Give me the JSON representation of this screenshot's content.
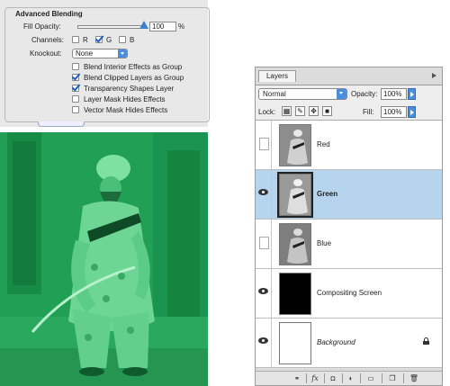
{
  "advanced_blending": {
    "title": "Advanced Blending",
    "fill_opacity_label": "Fill Opacity:",
    "fill_opacity_value": "100",
    "fill_opacity_unit": "%",
    "fill_opacity_level": 1.0,
    "channels_label": "Channels:",
    "channels": [
      {
        "label": "R",
        "checked": false
      },
      {
        "label": "G",
        "checked": true
      },
      {
        "label": "B",
        "checked": false
      }
    ],
    "knockout_label": "Knockout:",
    "knockout_value": "None",
    "options": [
      {
        "label": "Blend Interior Effects as Group",
        "checked": false
      },
      {
        "label": "Blend Clipped Layers as Group",
        "checked": true
      },
      {
        "label": "Transparency Shapes Layer",
        "checked": true
      },
      {
        "label": "Layer Mask Hides Effects",
        "checked": false
      },
      {
        "label": "Vector Mask Hides Effects",
        "checked": false
      }
    ]
  },
  "photo": {
    "tint_color": "#1e9a52"
  },
  "layers_panel": {
    "tab_label": "Layers",
    "blend_mode": "Normal",
    "opacity_label": "Opacity:",
    "opacity_value": "100%",
    "lock_label": "Lock:",
    "fill_label": "Fill:",
    "fill_value": "100%",
    "lock_icons": [
      "lock-transparent-icon",
      "lock-image-icon",
      "lock-position-icon",
      "lock-all-icon"
    ],
    "layers": [
      {
        "name": "Red",
        "visible": false,
        "selected": false,
        "thumb": "photo-gray",
        "style": "normal"
      },
      {
        "name": "Green",
        "visible": true,
        "selected": true,
        "thumb": "photo-gray",
        "style": "bold"
      },
      {
        "name": "Blue",
        "visible": false,
        "selected": false,
        "thumb": "photo-gray",
        "style": "normal"
      },
      {
        "name": "Compositing Screen",
        "visible": true,
        "selected": false,
        "thumb": "black",
        "style": "normal"
      },
      {
        "name": "Background",
        "visible": true,
        "selected": false,
        "thumb": "white",
        "style": "italic",
        "locked": true
      }
    ],
    "bottom_icons": [
      "link-icon",
      "fx-icon",
      "mask-icon",
      "adjustment-icon",
      "group-folder-icon",
      "new-layer-icon",
      "trash-icon"
    ],
    "fx_label": "fx",
    "selection_color": "#b7d4ee",
    "accent_color": "#4a8ee0"
  }
}
